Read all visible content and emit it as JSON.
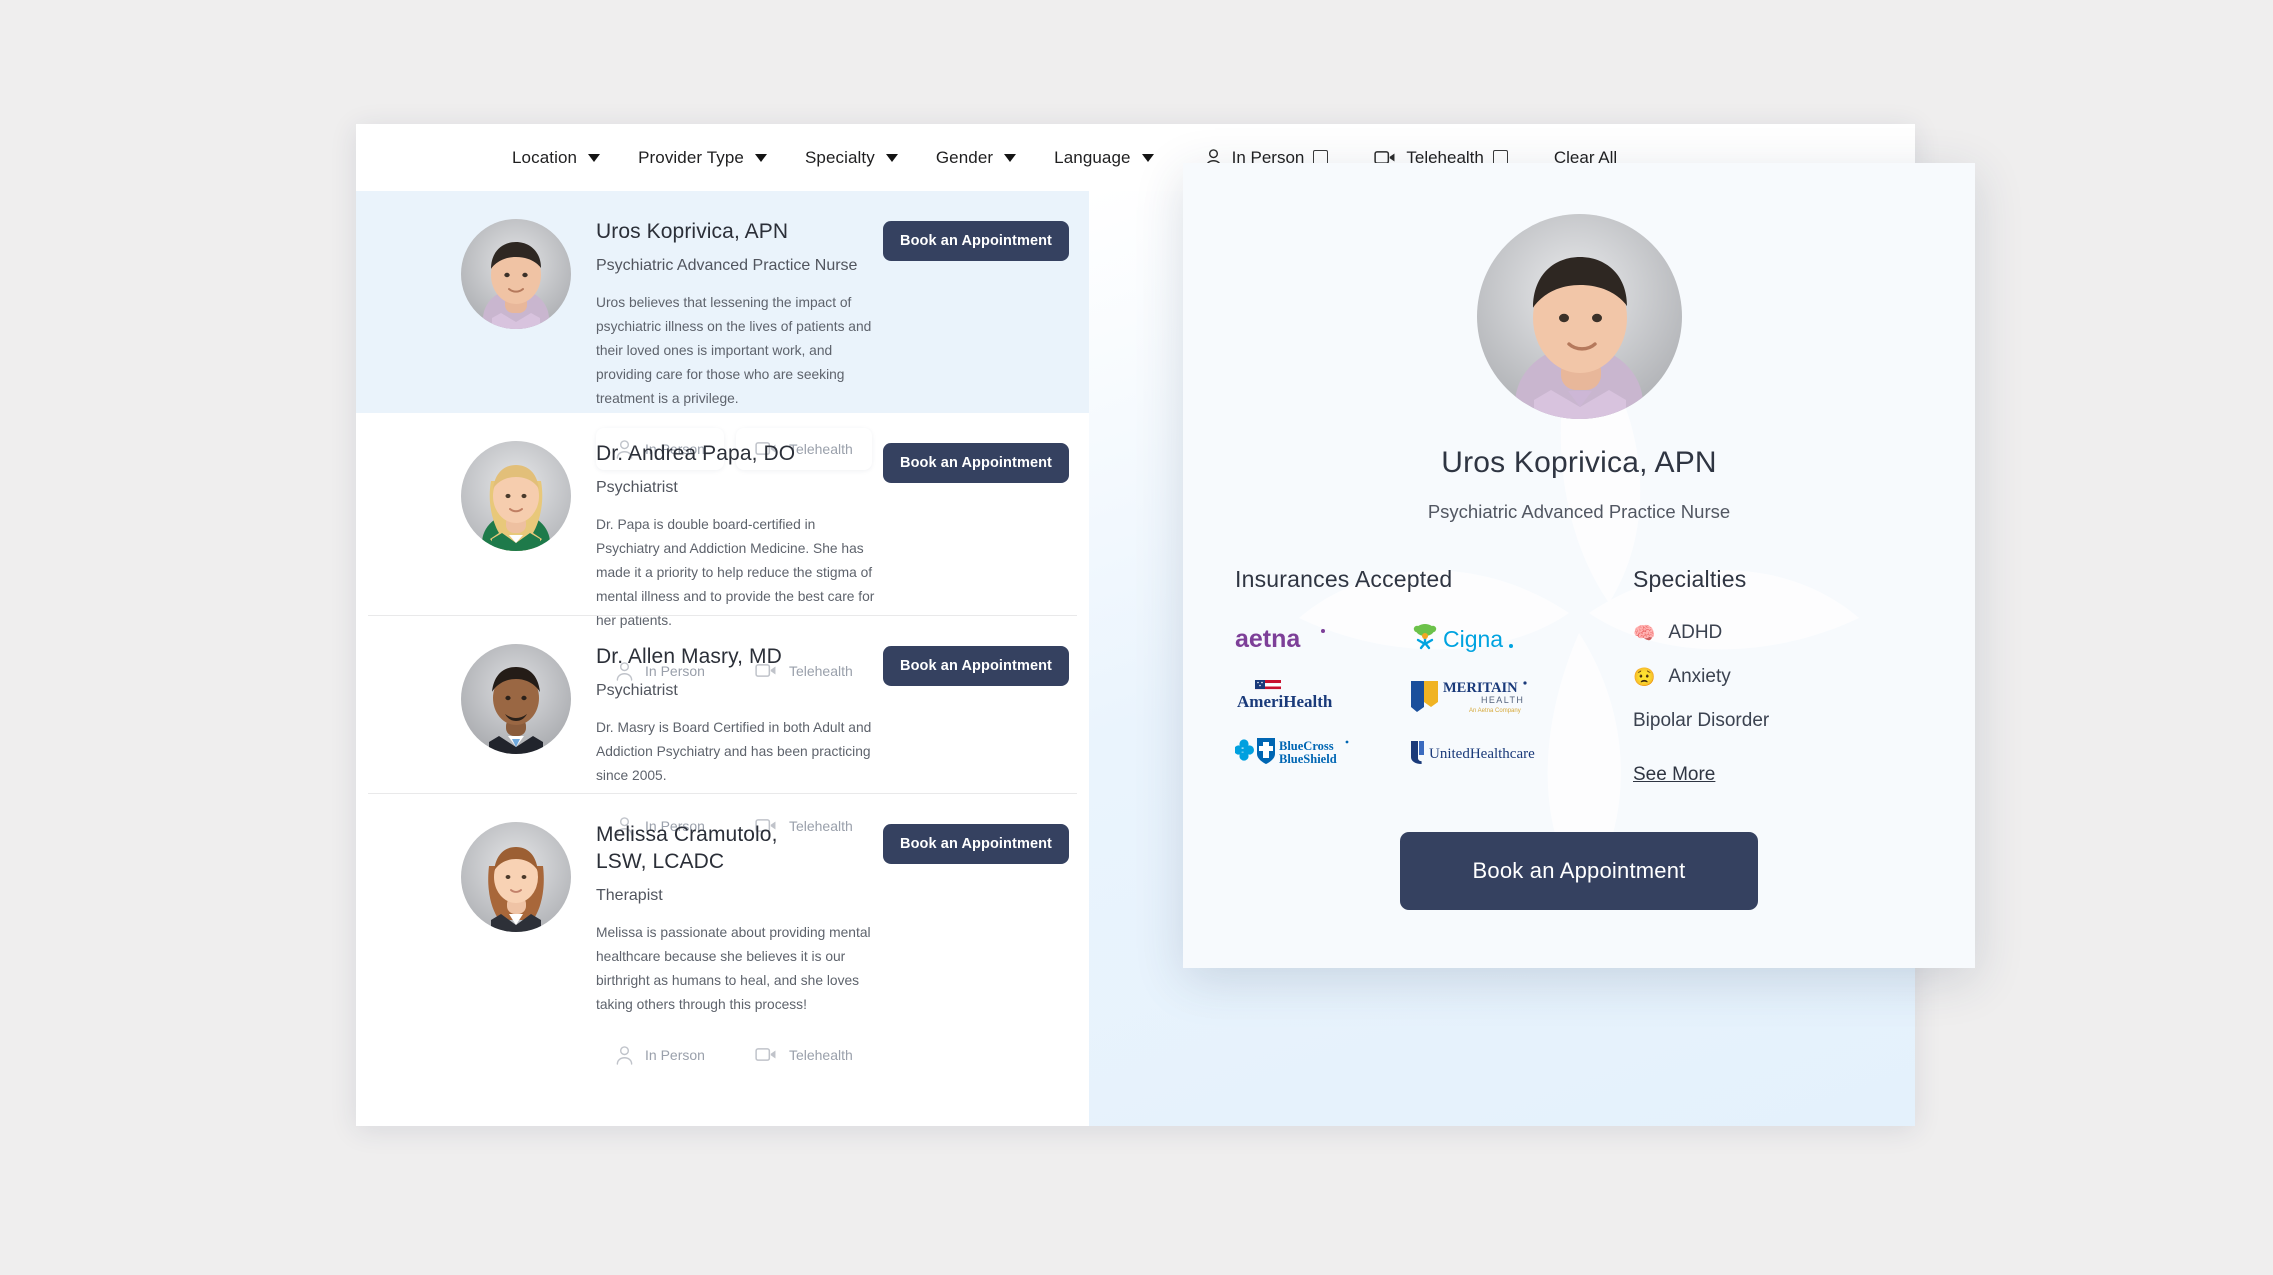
{
  "filter_bar": {
    "dropdowns": [
      {
        "label": "Location"
      },
      {
        "label": "Provider Type"
      },
      {
        "label": "Specialty"
      },
      {
        "label": "Gender"
      },
      {
        "label": "Language"
      }
    ],
    "mode_filters": [
      {
        "label": "In Person",
        "icon": "person-icon",
        "checked": false
      },
      {
        "label": "Telehealth",
        "icon": "video-camera-icon",
        "checked": false
      }
    ],
    "clear_all_label": "Clear All"
  },
  "providers": [
    {
      "name": "Uros Koprivica, APN",
      "title": "Psychiatric Advanced Practice Nurse",
      "bio": "Uros believes that lessening the impact of psychiatric illness on the lives of patients and their loved ones is important work, and providing care for those who are seeking treatment is a privilege.",
      "book_label": "Book an Appointment",
      "modes": [
        {
          "label": "In Person",
          "icon": "person-icon"
        },
        {
          "label": "Telehealth",
          "icon": "video-camera-icon"
        }
      ]
    },
    {
      "name": "Dr. Andrea Papa, DO",
      "title": "Psychiatrist",
      "bio": "Dr. Papa is double board-certified in Psychiatry and Addiction Medicine. She has made it a priority to help reduce the stigma of mental illness and to provide the best care for her patients.",
      "book_label": "Book an Appointment",
      "modes": [
        {
          "label": "In Person",
          "icon": "person-icon"
        },
        {
          "label": "Telehealth",
          "icon": "video-camera-icon"
        }
      ]
    },
    {
      "name": "Dr. Allen Masry, MD",
      "title": "Psychiatrist",
      "bio": "Dr.  Masry is Board Certified in both Adult and Addiction Psychiatry and has been practicing since 2005.",
      "book_label": "Book an Appointment",
      "modes": [
        {
          "label": "In Person",
          "icon": "person-icon"
        },
        {
          "label": "Telehealth",
          "icon": "video-camera-icon"
        }
      ]
    },
    {
      "name": "Melissa Cramutolo, LSW, LCADC",
      "title": "Therapist",
      "bio": "Melissa is passionate about providing mental healthcare because she believes it is our birthright as humans to heal, and she loves taking others through this process!",
      "book_label": "Book an Appointment",
      "modes": [
        {
          "label": "In Person",
          "icon": "person-icon"
        },
        {
          "label": "Telehealth",
          "icon": "video-camera-icon"
        }
      ]
    }
  ],
  "detail_panel": {
    "name": "Uros Koprivica, APN",
    "title": "Psychiatric Advanced Practice Nurse",
    "insurances_heading": "Insurances Accepted",
    "insurances": [
      {
        "name": "aetna"
      },
      {
        "name": "Cigna"
      },
      {
        "name": "AmeriHealth"
      },
      {
        "name": "MERITAIN HEALTH"
      },
      {
        "name": "BlueCross BlueShield"
      },
      {
        "name": "UnitedHealthcare"
      }
    ],
    "specialties_heading": "Specialties",
    "specialties": [
      {
        "label": "ADHD",
        "emoji": "🧠"
      },
      {
        "label": "Anxiety",
        "emoji": "😟"
      },
      {
        "label": "Bipolar Disorder",
        "emoji": ""
      }
    ],
    "see_more_label": "See More",
    "cta_label": "Book an Appointment"
  },
  "colors": {
    "navy": "#354160",
    "page_bg": "#efeeee",
    "highlight_row": "#eaf3fb",
    "panel_bg": "#f7fafd"
  }
}
